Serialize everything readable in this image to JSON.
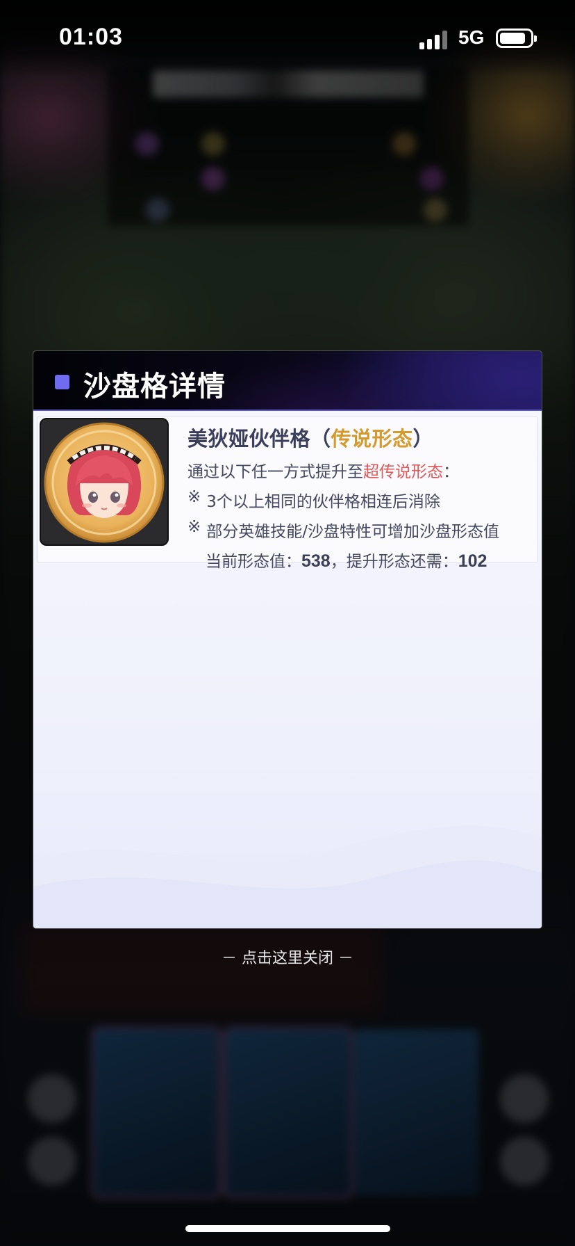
{
  "status_bar": {
    "time": "01:03",
    "network": "5G"
  },
  "modal": {
    "title": "沙盘格详情",
    "item": {
      "name_prefix": "美狄娅伙伴格",
      "paren_open": "（",
      "form": "传说形态",
      "paren_close": "）",
      "line1_prefix": "通过以下任一方式提升至",
      "line1_highlight": "超传说形态",
      "line1_suffix": "：",
      "bullet_symbol": "※",
      "rule1": "3个以上相同的伙伴格相连后消除",
      "rule2": "部分英雄技能/沙盘特性可增加沙盘形态值",
      "current_label": "当前形态值：",
      "current_value": "538",
      "need_label": "，提升形态还需：",
      "need_value": "102"
    },
    "colors": {
      "form": "#d59a2e",
      "highlight": "#e2585a",
      "bullet": "#6f6cf0"
    }
  },
  "close_hint": "－ 点击这里关闭 －"
}
